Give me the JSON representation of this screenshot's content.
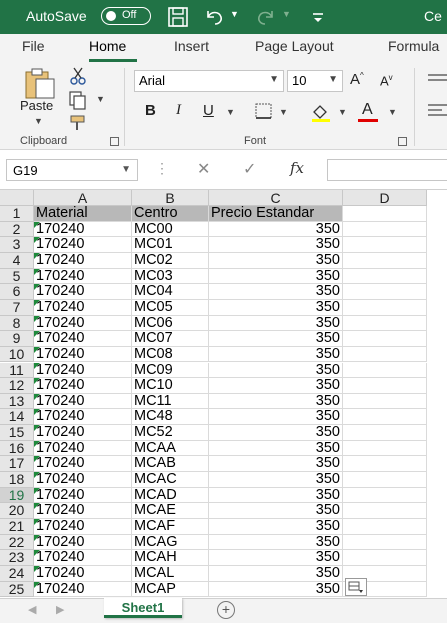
{
  "titlebar": {
    "autosave_label": "AutoSave",
    "autosave_state": "Off",
    "doc_title": "Ce"
  },
  "tabs": [
    "File",
    "Home",
    "Insert",
    "Page Layout",
    "Formula"
  ],
  "active_tab": "Home",
  "ribbon": {
    "clipboard": {
      "paste_label": "Paste",
      "group_label": "Clipboard"
    },
    "font": {
      "font_name": "Arial",
      "font_size": "10",
      "grow_label": "A",
      "shrink_label": "A",
      "bold": "B",
      "italic": "I",
      "underline": "U",
      "font_color_label": "A",
      "group_label": "Font"
    }
  },
  "formula_bar": {
    "name_box": "G19",
    "fx_label": "fx",
    "formula": ""
  },
  "sheet": {
    "columns": [
      "A",
      "B",
      "C",
      "D"
    ],
    "headers": [
      "Material",
      "Centro",
      "Precio Estandar"
    ],
    "rows": [
      [
        "170240",
        "MC00",
        "350"
      ],
      [
        "170240",
        "MC01",
        "350"
      ],
      [
        "170240",
        "MC02",
        "350"
      ],
      [
        "170240",
        "MC03",
        "350"
      ],
      [
        "170240",
        "MC04",
        "350"
      ],
      [
        "170240",
        "MC05",
        "350"
      ],
      [
        "170240",
        "MC06",
        "350"
      ],
      [
        "170240",
        "MC07",
        "350"
      ],
      [
        "170240",
        "MC08",
        "350"
      ],
      [
        "170240",
        "MC09",
        "350"
      ],
      [
        "170240",
        "MC10",
        "350"
      ],
      [
        "170240",
        "MC11",
        "350"
      ],
      [
        "170240",
        "MC48",
        "350"
      ],
      [
        "170240",
        "MC52",
        "350"
      ],
      [
        "170240",
        "MCAA",
        "350"
      ],
      [
        "170240",
        "MCAB",
        "350"
      ],
      [
        "170240",
        "MCAC",
        "350"
      ],
      [
        "170240",
        "MCAD",
        "350"
      ],
      [
        "170240",
        "MCAE",
        "350"
      ],
      [
        "170240",
        "MCAF",
        "350"
      ],
      [
        "170240",
        "MCAG",
        "350"
      ],
      [
        "170240",
        "MCAH",
        "350"
      ],
      [
        "170240",
        "MCAL",
        "350"
      ],
      [
        "170240",
        "MCAP",
        "350"
      ]
    ],
    "selected_row": 19
  },
  "sheet_tabs": {
    "active": "Sheet1"
  },
  "colors": {
    "accent": "#217346",
    "header_fill": "#b8b8b8",
    "error_triangle": "#1e8a3c"
  }
}
